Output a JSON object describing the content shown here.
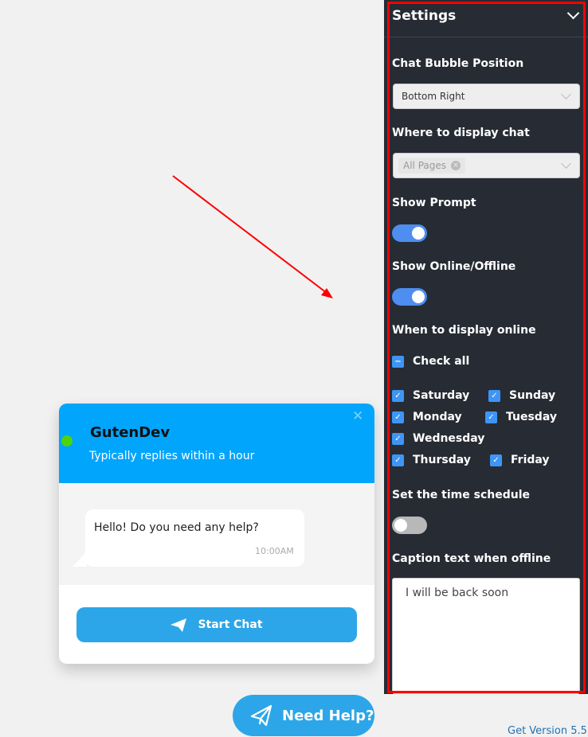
{
  "settings": {
    "title": "Settings",
    "bubble_position": {
      "label": "Chat Bubble Position",
      "value": "Bottom Right"
    },
    "display_chat": {
      "label": "Where to display chat",
      "tag": "All Pages"
    },
    "show_prompt": {
      "label": "Show Prompt",
      "on": true
    },
    "show_online": {
      "label": "Show Online/Offline",
      "on": true
    },
    "when_online": {
      "label": "When to display online",
      "check_all": "Check all",
      "days": [
        {
          "label": "Saturday",
          "checked": true
        },
        {
          "label": "Sunday",
          "checked": true
        },
        {
          "label": "Monday",
          "checked": true
        },
        {
          "label": "Tuesday",
          "checked": true
        },
        {
          "label": "Wednesday",
          "checked": true
        },
        {
          "label": "Thursday",
          "checked": true
        },
        {
          "label": "Friday",
          "checked": true
        }
      ]
    },
    "time_schedule": {
      "label": "Set the time schedule",
      "on": false
    },
    "caption": {
      "label": "Caption text when offline",
      "value": "I will be back soon"
    }
  },
  "chat": {
    "name": "GutenDev",
    "status": "Typically replies within a hour",
    "message": "Hello! Do you need any help?",
    "time": "10:00AM",
    "start_button": "Start Chat",
    "bubble": "Need Help?",
    "online_color": "#4fd40c",
    "accent": "#02a5fc"
  },
  "footer": {
    "link": "Get Version 5.5"
  }
}
